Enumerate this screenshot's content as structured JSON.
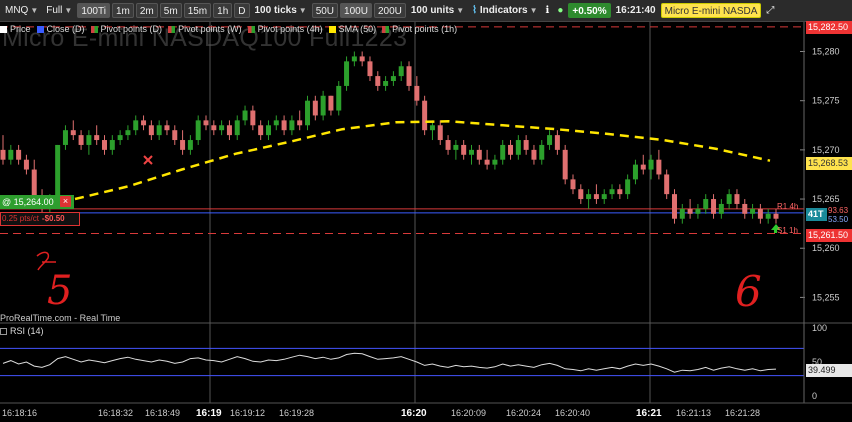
{
  "toolbar": {
    "instrument": "MNQ",
    "view_mode": "Full",
    "timeframes": [
      "100Ti",
      "1m",
      "2m",
      "5m",
      "15m",
      "1h",
      "D"
    ],
    "ticks_label": "100 ticks",
    "volume_options": [
      "50U",
      "100U",
      "200U"
    ],
    "units_label": "100 units",
    "indicators_label": "Indicators",
    "change_label": "+0.50%",
    "clock": "16:21:40",
    "instrument_title": "Micro E-mini NASDA"
  },
  "legend": {
    "price": "Price",
    "close": "Close (D)",
    "pivot_d": "Pivot points (D)",
    "pivot_w": "Pivot points (W)",
    "pivot_4h": "Pivot points (4h)",
    "sma": "SMA (50)",
    "pivot_1h": "Pivot points (1h)"
  },
  "watermark": "Micro E-mini NASDAQ100 Full1223",
  "order_tag": {
    "price_label": "@ 15,264.00",
    "close_symbol": "×",
    "pts_label": "0.25 pts/ct",
    "pnl": "-$0.50"
  },
  "price_axis": {
    "ticks": [
      "15,280",
      "15,275",
      "15,270",
      "15,265",
      "15,260",
      "15,255"
    ],
    "top_tag": "15,282.50",
    "sma_tag": "15,268.53",
    "low_tag": "15,261.50",
    "last_tag": "41T",
    "right_labels": [
      "93.63",
      "53.50"
    ]
  },
  "pivot_labels": {
    "upper": "R1 4h",
    "lower": "S1 1h"
  },
  "time_axis": {
    "labels": [
      "16:18:16",
      "16:18:32",
      "16:18:49",
      "16:19",
      "16:19:12",
      "16:19:28",
      "16:20",
      "16:20:09",
      "16:20:24",
      "16:20:40",
      "16:21",
      "16:21:13",
      "16:21:28"
    ],
    "bold": [
      "16:19",
      "16:20",
      "16:21"
    ]
  },
  "copyright": "ProRealTime.com - Real Time",
  "rsi": {
    "label": "RSI (14)",
    "ticks": [
      "100",
      "50",
      "0"
    ],
    "value": "39.499"
  },
  "annotations": [
    "5",
    "6"
  ],
  "colors": {
    "up": "#2ca02c",
    "down": "#e07070",
    "sma": "#ffe600",
    "pivot_line": "#d83a3a",
    "accent_green": "#2e8b2e"
  },
  "chart_data": {
    "type": "candlestick",
    "ylim": [
      15252.5,
      15283
    ],
    "sma_period": 50,
    "sma": [
      15265.0,
      15266.3,
      15268.0,
      15269.6,
      15270.8,
      15272.1,
      15272.8,
      15272.9,
      15272.5,
      15272.1,
      15271.6,
      15271.0,
      15270.1,
      15268.9
    ],
    "candles": [
      [
        15270.0,
        15271.5,
        15268.5,
        15269.0
      ],
      [
        15269.0,
        15270.5,
        15268.5,
        15270.0
      ],
      [
        15270.0,
        15270.5,
        15268.5,
        15269.0
      ],
      [
        15269.0,
        15269.5,
        15267.5,
        15268.0
      ],
      [
        15268.0,
        15269.0,
        15264.5,
        15265.0
      ],
      [
        15265.0,
        15266.0,
        15263.5,
        15264.5
      ],
      [
        15264.5,
        15265.5,
        15263.5,
        15265.0
      ],
      [
        15265.0,
        15270.5,
        15264.5,
        15270.5
      ],
      [
        15270.5,
        15272.5,
        15270.0,
        15272.0
      ],
      [
        15272.0,
        15273.0,
        15271.0,
        15271.5
      ],
      [
        15271.5,
        15272.0,
        15270.0,
        15270.5
      ],
      [
        15270.5,
        15272.0,
        15269.5,
        15271.5
      ],
      [
        15271.5,
        15272.5,
        15270.5,
        15271.0
      ],
      [
        15271.0,
        15271.5,
        15269.5,
        15270.0
      ],
      [
        15270.0,
        15271.5,
        15269.5,
        15271.0
      ],
      [
        15271.0,
        15272.0,
        15270.5,
        15271.5
      ],
      [
        15271.5,
        15272.5,
        15271.0,
        15272.0
      ],
      [
        15272.0,
        15273.5,
        15271.5,
        15273.0
      ],
      [
        15273.0,
        15273.5,
        15272.0,
        15272.5
      ],
      [
        15272.5,
        15273.0,
        15271.0,
        15271.5
      ],
      [
        15271.5,
        15273.0,
        15271.0,
        15272.5
      ],
      [
        15272.5,
        15273.0,
        15271.5,
        15272.0
      ],
      [
        15272.0,
        15272.5,
        15270.5,
        15271.0
      ],
      [
        15271.0,
        15272.0,
        15269.5,
        15270.0
      ],
      [
        15270.0,
        15271.5,
        15269.5,
        15271.0
      ],
      [
        15271.0,
        15273.5,
        15270.5,
        15273.0
      ],
      [
        15273.0,
        15273.5,
        15272.0,
        15272.5
      ],
      [
        15272.5,
        15273.0,
        15271.5,
        15272.0
      ],
      [
        15272.0,
        15273.0,
        15271.5,
        15272.5
      ],
      [
        15272.5,
        15273.0,
        15271.0,
        15271.5
      ],
      [
        15271.5,
        15273.5,
        15271.0,
        15273.0
      ],
      [
        15273.0,
        15274.5,
        15272.5,
        15274.0
      ],
      [
        15274.0,
        15274.5,
        15272.0,
        15272.5
      ],
      [
        15272.5,
        15273.0,
        15271.0,
        15271.5
      ],
      [
        15271.5,
        15273.0,
        15271.0,
        15272.5
      ],
      [
        15272.5,
        15273.5,
        15272.0,
        15273.0
      ],
      [
        15273.0,
        15273.5,
        15271.5,
        15272.0
      ],
      [
        15272.0,
        15273.5,
        15271.5,
        15273.0
      ],
      [
        15273.0,
        15274.0,
        15272.0,
        15272.5
      ],
      [
        15272.5,
        15275.5,
        15272.0,
        15275.0
      ],
      [
        15275.0,
        15275.5,
        15273.0,
        15273.5
      ],
      [
        15273.5,
        15276.0,
        15273.0,
        15275.5
      ],
      [
        15275.5,
        15275.5,
        15273.5,
        15274.0
      ],
      [
        15274.0,
        15277.0,
        15273.5,
        15276.5
      ],
      [
        15276.5,
        15279.5,
        15276.0,
        15279.0
      ],
      [
        15279.0,
        15280.0,
        15278.5,
        15279.5
      ],
      [
        15279.5,
        15280.0,
        15278.5,
        15279.0
      ],
      [
        15279.0,
        15279.5,
        15277.0,
        15277.5
      ],
      [
        15277.5,
        15278.0,
        15276.0,
        15276.5
      ],
      [
        15276.5,
        15277.5,
        15276.0,
        15277.0
      ],
      [
        15277.0,
        15278.0,
        15276.5,
        15277.5
      ],
      [
        15277.5,
        15279.0,
        15277.0,
        15278.5
      ],
      [
        15278.5,
        15279.0,
        15276.0,
        15276.5
      ],
      [
        15276.5,
        15277.5,
        15274.5,
        15275.0
      ],
      [
        15275.0,
        15275.5,
        15271.5,
        15272.0
      ],
      [
        15272.0,
        15273.0,
        15271.0,
        15272.5
      ],
      [
        15272.5,
        15273.0,
        15270.5,
        15271.0
      ],
      [
        15271.0,
        15271.5,
        15269.5,
        15270.0
      ],
      [
        15270.0,
        15271.0,
        15269.0,
        15270.5
      ],
      [
        15270.5,
        15271.0,
        15269.0,
        15269.5
      ],
      [
        15269.5,
        15270.5,
        15268.5,
        15270.0
      ],
      [
        15270.0,
        15270.5,
        15268.5,
        15269.0
      ],
      [
        15269.0,
        15270.0,
        15268.0,
        15268.5
      ],
      [
        15268.5,
        15269.5,
        15268.0,
        15269.0
      ],
      [
        15269.0,
        15271.0,
        15268.5,
        15270.5
      ],
      [
        15270.5,
        15271.0,
        15269.0,
        15269.5
      ],
      [
        15269.5,
        15271.5,
        15269.0,
        15271.0
      ],
      [
        15271.0,
        15271.5,
        15269.5,
        15270.0
      ],
      [
        15270.0,
        15270.5,
        15268.5,
        15269.0
      ],
      [
        15269.0,
        15271.0,
        15268.5,
        15270.5
      ],
      [
        15270.5,
        15272.0,
        15270.0,
        15271.5
      ],
      [
        15271.5,
        15272.0,
        15269.5,
        15270.0
      ],
      [
        15270.0,
        15270.5,
        15266.5,
        15267.0
      ],
      [
        15267.0,
        15267.5,
        15265.5,
        15266.0
      ],
      [
        15266.0,
        15266.5,
        15264.5,
        15265.0
      ],
      [
        15265.0,
        15266.0,
        15264.0,
        15265.5
      ],
      [
        15265.5,
        15266.5,
        15264.5,
        15265.0
      ],
      [
        15265.0,
        15266.0,
        15264.5,
        15265.5
      ],
      [
        15265.5,
        15266.5,
        15265.0,
        15266.0
      ],
      [
        15266.0,
        15266.5,
        15265.0,
        15265.5
      ],
      [
        15265.5,
        15267.5,
        15265.0,
        15267.0
      ],
      [
        15267.0,
        15269.0,
        15266.5,
        15268.5
      ],
      [
        15268.5,
        15269.5,
        15267.5,
        15268.0
      ],
      [
        15268.0,
        15269.5,
        15267.0,
        15269.0
      ],
      [
        15269.0,
        15270.0,
        15267.0,
        15267.5
      ],
      [
        15267.5,
        15268.0,
        15265.0,
        15265.5
      ],
      [
        15265.5,
        15266.0,
        15262.5,
        15263.0
      ],
      [
        15263.0,
        15264.5,
        15262.5,
        15264.0
      ],
      [
        15264.0,
        15265.0,
        15263.0,
        15263.5
      ],
      [
        15263.5,
        15264.5,
        15263.0,
        15264.0
      ],
      [
        15264.0,
        15265.5,
        15263.5,
        15265.0
      ],
      [
        15265.0,
        15265.5,
        15263.0,
        15263.5
      ],
      [
        15263.5,
        15265.0,
        15263.0,
        15264.5
      ],
      [
        15264.5,
        15266.0,
        15264.0,
        15265.5
      ],
      [
        15265.5,
        15266.0,
        15264.0,
        15264.5
      ],
      [
        15264.5,
        15265.0,
        15263.0,
        15263.5
      ],
      [
        15263.5,
        15264.5,
        15263.0,
        15264.0
      ],
      [
        15264.0,
        15264.5,
        15262.5,
        15263.0
      ],
      [
        15263.0,
        15264.0,
        15262.5,
        15263.5
      ],
      [
        15263.5,
        15264.0,
        15262.5,
        15263.0
      ]
    ],
    "hlines": [
      {
        "name": "R1 4h",
        "value": 15264.0,
        "color": "#d83a3a",
        "style": "solid"
      },
      {
        "name": "S1 1h",
        "value": 15261.5,
        "color": "#d83a3a",
        "style": "dashed"
      },
      {
        "name": "Pivot top",
        "value": 15282.5,
        "color": "#d83a3a",
        "style": "dashed"
      },
      {
        "name": "Blue line",
        "value": 15263.6,
        "color": "#3a5cff",
        "style": "solid"
      }
    ],
    "rsi": {
      "range": [
        0,
        100
      ],
      "bands": [
        70,
        30
      ],
      "values": [
        48,
        52,
        47,
        50,
        44,
        42,
        46,
        55,
        58,
        54,
        50,
        53,
        51,
        49,
        52,
        55,
        57,
        54,
        52,
        50,
        53,
        51,
        48,
        50,
        55,
        56,
        53,
        52,
        50,
        54,
        58,
        55,
        51,
        50,
        53,
        52,
        54,
        57,
        60,
        58,
        55,
        57,
        54,
        56,
        61,
        63,
        62,
        58,
        54,
        55,
        56,
        58,
        54,
        50,
        45,
        47,
        44,
        42,
        45,
        43,
        44,
        42,
        41,
        43,
        47,
        44,
        46,
        44,
        42,
        46,
        48,
        45,
        40,
        39,
        37,
        40,
        38,
        40,
        42,
        40,
        44,
        47,
        45,
        47,
        44,
        40,
        35,
        38,
        37,
        39,
        42,
        38,
        41,
        43,
        40,
        38,
        40,
        37,
        39,
        39.5
      ]
    }
  }
}
